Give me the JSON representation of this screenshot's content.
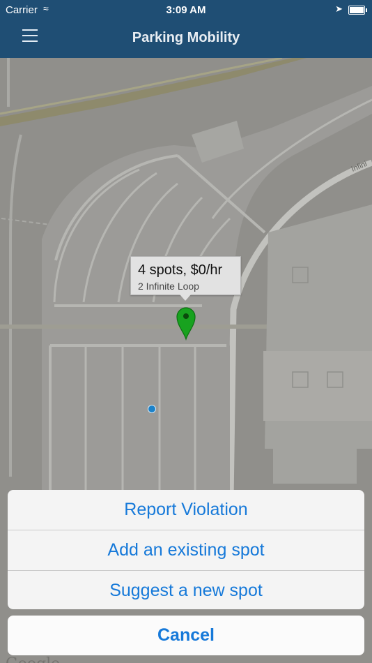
{
  "status_bar": {
    "carrier": "Carrier",
    "time": "3:09 AM",
    "wifi_icon": "wifi-icon",
    "location_icon": "location-arrow-icon",
    "battery_icon": "battery-icon"
  },
  "nav": {
    "title": "Parking Mobility",
    "menu_icon": "hamburger-menu-icon"
  },
  "map": {
    "street_label": "Infini",
    "attribution": "Google",
    "callout": {
      "title": "4 spots, $0/hr",
      "subtitle": "2 Infinite Loop"
    },
    "pin_color": "#18a21f",
    "user_location_color": "#1c82c9"
  },
  "action_sheet": {
    "actions": [
      {
        "label": "Report Violation"
      },
      {
        "label": "Add an existing spot"
      },
      {
        "label": "Suggest a new spot"
      }
    ],
    "cancel_label": "Cancel"
  },
  "colors": {
    "nav_bar": "#1f4e74",
    "action_text": "#1679d9"
  }
}
